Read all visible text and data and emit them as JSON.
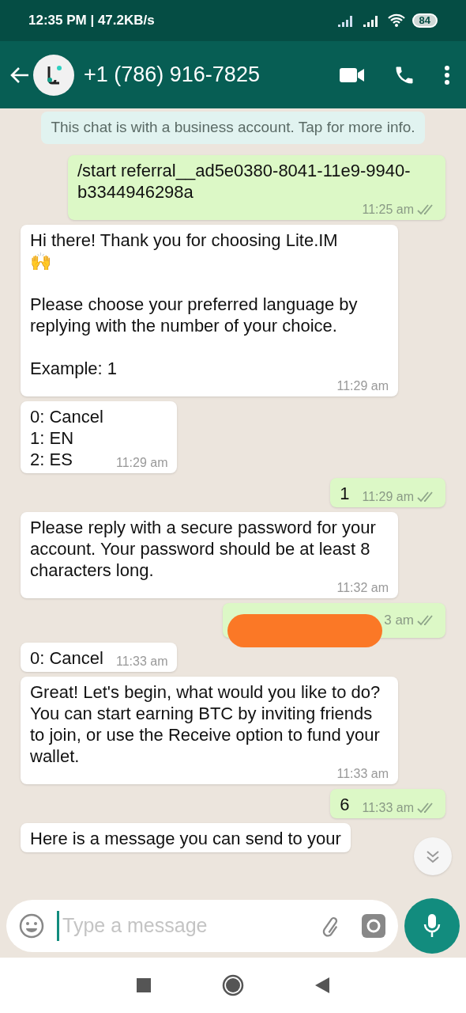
{
  "status_bar": {
    "time": "12:35 PM | 47.2KB/s",
    "battery": "84"
  },
  "header": {
    "title": "+1 (786) 916-7825"
  },
  "notice": "This chat is with a business account. Tap for more info.",
  "messages": [
    {
      "kind": "out",
      "text": "/start referral__ad5e0380-8041-11e9-9940-b3344946298a",
      "time": "11:25 am",
      "read": false
    },
    {
      "kind": "in",
      "text": "Hi there! Thank you for choosing Lite.IM\n🙌\n\nPlease choose your preferred language by replying with the number of your choice.\n\nExample: 1",
      "time": "11:29 am"
    },
    {
      "kind": "in",
      "text": "0: Cancel\n1: EN\n2: ES",
      "time": "11:29 am"
    },
    {
      "kind": "out",
      "text": "1",
      "time": "11:29 am",
      "read": false
    },
    {
      "kind": "in",
      "text": "Please reply with a secure password for your account. Your password should be at least 8 characters long.",
      "time": "11:32 am"
    },
    {
      "kind": "redacted",
      "time": "3 am",
      "read": false
    },
    {
      "kind": "in",
      "text": "0: Cancel",
      "time": "11:33 am"
    },
    {
      "kind": "in",
      "text": "Great! Let's begin, what would you like to do? You can start earning BTC by inviting friends to join, or use the Receive option to fund your wallet.",
      "time": "11:33 am"
    },
    {
      "kind": "out",
      "text": "6",
      "time": "11:33 am",
      "read": false
    },
    {
      "kind": "in",
      "text": "Here is a message you can send to your"
    }
  ],
  "composer": {
    "placeholder": "Type a message"
  }
}
